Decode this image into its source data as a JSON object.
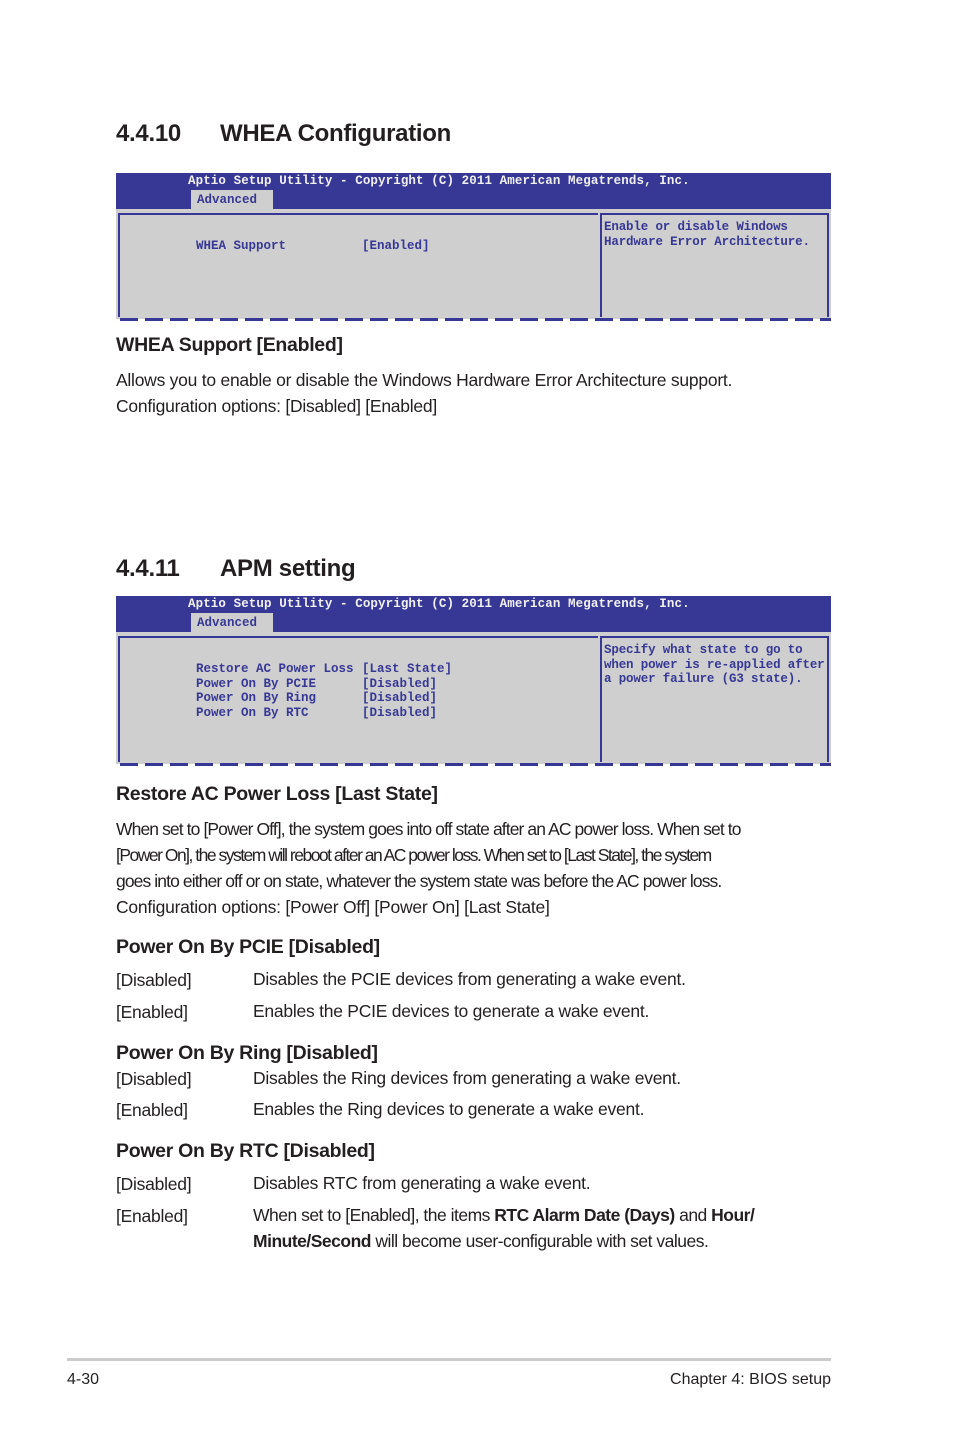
{
  "sections": [
    {
      "number": "4.4.10",
      "title": "WHEA Configuration",
      "bios": {
        "header": "Aptio Setup Utility - Copyright (C) 2011 American Megatrends, Inc.",
        "tab": "Advanced",
        "items": [
          {
            "label": "WHEA Support",
            "value": "[Enabled]"
          }
        ],
        "help_lines": [
          "Enable or disable Windows",
          "Hardware Error Architecture."
        ]
      },
      "subsections": [
        {
          "heading": "WHEA Support [Enabled]",
          "paragraph_lines": [
            "Allows you to enable or disable the Windows Hardware Error Architecture support.",
            "Configuration options: [Disabled] [Enabled]"
          ]
        }
      ]
    },
    {
      "number": "4.4.11",
      "title": "APM setting",
      "bios": {
        "header": "Aptio Setup Utility - Copyright (C) 2011 American Megatrends, Inc.",
        "tab": "Advanced",
        "items": [
          {
            "label": "Restore AC Power Loss",
            "value": "[Last State]"
          },
          {
            "label": "Power On By PCIE",
            "value": "[Disabled]"
          },
          {
            "label": "Power On By Ring",
            "value": "[Disabled]"
          },
          {
            "label": "Power On By RTC",
            "value": "[Disabled]"
          }
        ],
        "help_lines": [
          "Specify what state to go to",
          "when power is re-applied after",
          "a power failure (G3 state)."
        ]
      },
      "subsections": [
        {
          "heading": "Restore AC Power Loss [Last State]",
          "paragraph_lines": [
            "When set to [Power Off], the system goes into off state after an AC power loss. When set to",
            "[Power On], the system will reboot after an AC power loss. When set to [Last State], the system",
            "goes into either off or on state, whatever the system state was before the AC power loss.",
            "Configuration options: [Power Off] [Power On] [Last State]"
          ]
        },
        {
          "heading": "Power On By PCIE [Disabled]",
          "options": [
            {
              "key": "[Disabled]",
              "desc": "Disables the PCIE devices from generating a wake event."
            },
            {
              "key": "[Enabled]",
              "desc": "Enables the PCIE devices to generate a wake event."
            }
          ]
        },
        {
          "heading": "Power On By Ring [Disabled]",
          "options": [
            {
              "key": "[Disabled]",
              "desc": "Disables the Ring devices from generating a wake event."
            },
            {
              "key": "[Enabled]",
              "desc": "Enables the Ring devices to generate a wake event."
            }
          ]
        },
        {
          "heading": "Power On By RTC [Disabled]",
          "options": [
            {
              "key": "[Disabled]",
              "desc": "Disables RTC from generating a wake event."
            },
            {
              "key": "[Enabled]",
              "desc_parts": {
                "t1": "When set to [Enabled], the items ",
                "b1": "RTC Alarm Date (Days)",
                "t2": " and ",
                "b2": "Hour/",
                "b3": "Minute/Second",
                "t3": " will become user-configurable with set values."
              }
            }
          ]
        }
      ]
    }
  ],
  "footer": {
    "page_number": "4-30",
    "chapter": "Chapter 4: BIOS setup"
  },
  "colors": {
    "bios_blue": "#373895",
    "bios_gray": "#cfcfcf",
    "text": "#231f20"
  }
}
